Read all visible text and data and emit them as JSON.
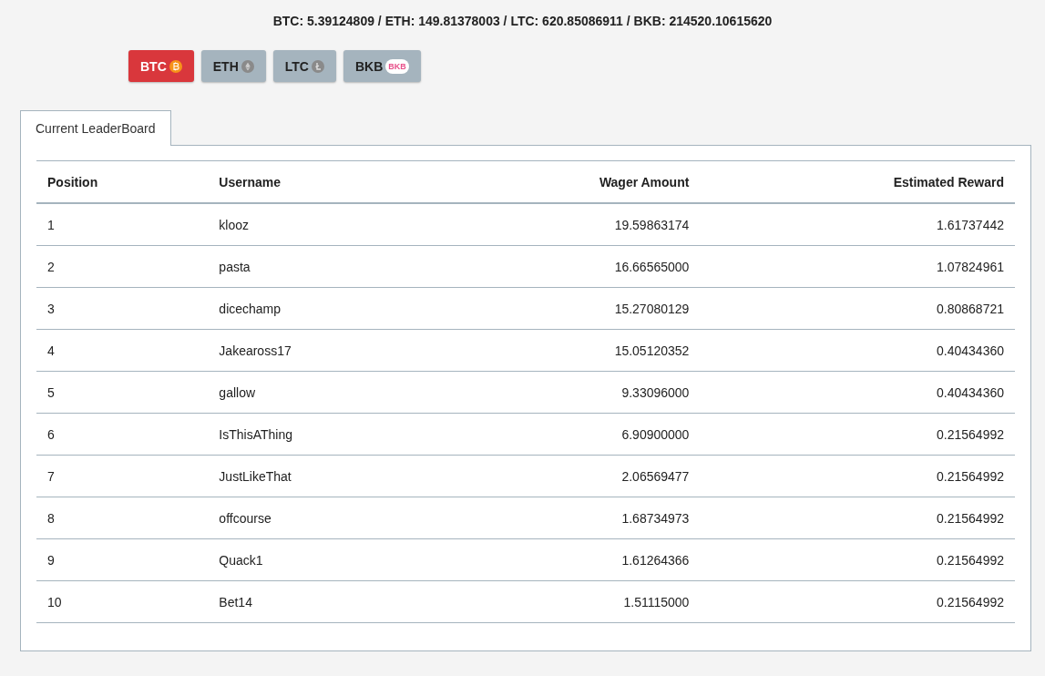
{
  "balances": "BTC: 5.39124809 / ETH: 149.81378003 / LTC: 620.85086911 / BKB: 214520.10615620",
  "coins": [
    {
      "label": "BTC",
      "kind": "btc",
      "selected": true
    },
    {
      "label": "ETH",
      "kind": "eth",
      "selected": false
    },
    {
      "label": "LTC",
      "kind": "ltc",
      "selected": false
    },
    {
      "label": "BKB",
      "kind": "bkb",
      "selected": false,
      "logo_text": "BKB"
    }
  ],
  "tabs": [
    {
      "label": "Current LeaderBoard",
      "selected": true
    }
  ],
  "table": {
    "columns": [
      "Position",
      "Username",
      "Wager Amount",
      "Estimated Reward"
    ],
    "rows": [
      [
        "1",
        "klooz",
        "19.59863174",
        "1.61737442"
      ],
      [
        "2",
        "pasta",
        "16.66565000",
        "1.07824961"
      ],
      [
        "3",
        "dicechamp",
        "15.27080129",
        "0.80868721"
      ],
      [
        "4",
        "Jakeaross17",
        "15.05120352",
        "0.40434360"
      ],
      [
        "5",
        "gallow",
        "9.33096000",
        "0.40434360"
      ],
      [
        "6",
        "IsThisAThing",
        "6.90900000",
        "0.21564992"
      ],
      [
        "7",
        "JustLikeThat",
        "2.06569477",
        "0.21564992"
      ],
      [
        "8",
        "offcourse",
        "1.68734973",
        "0.21564992"
      ],
      [
        "9",
        "Quack1",
        "1.61264366",
        "0.21564992"
      ],
      [
        "10",
        "Bet14",
        "1.51115000",
        "0.21564992"
      ]
    ]
  }
}
